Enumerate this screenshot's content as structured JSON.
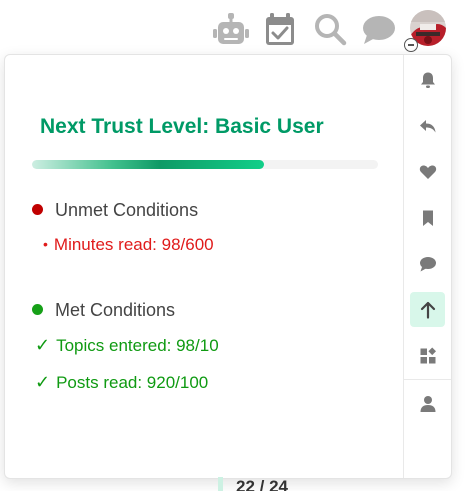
{
  "header": {
    "icons": [
      "robot-icon",
      "calendar-check-icon",
      "search-icon",
      "chat-bubble-icon"
    ],
    "avatar_status": "minus"
  },
  "trust_panel": {
    "title": "Next Trust Level: Basic User",
    "progress": 0.67,
    "colors": {
      "accent": "#009a66",
      "unmet": "#c00000",
      "met": "#16a018"
    },
    "unmet": {
      "heading": "Unmet Conditions",
      "items": [
        {
          "label": "Minutes read: 98/600"
        }
      ]
    },
    "met": {
      "heading": "Met Conditions",
      "items": [
        {
          "label": "Topics entered: 98/10"
        },
        {
          "label": "Posts read: 920/100"
        }
      ]
    }
  },
  "sidebar": {
    "items": [
      {
        "icon": "bell-icon"
      },
      {
        "icon": "reply-icon"
      },
      {
        "icon": "heart-icon"
      },
      {
        "icon": "bookmark-icon"
      },
      {
        "icon": "chat-bubble-icon"
      },
      {
        "icon": "arrow-up-icon",
        "active": true
      },
      {
        "icon": "widgets-icon"
      },
      {
        "icon": "user-icon"
      }
    ]
  },
  "footer": {
    "post_counter": "22 / 24"
  }
}
